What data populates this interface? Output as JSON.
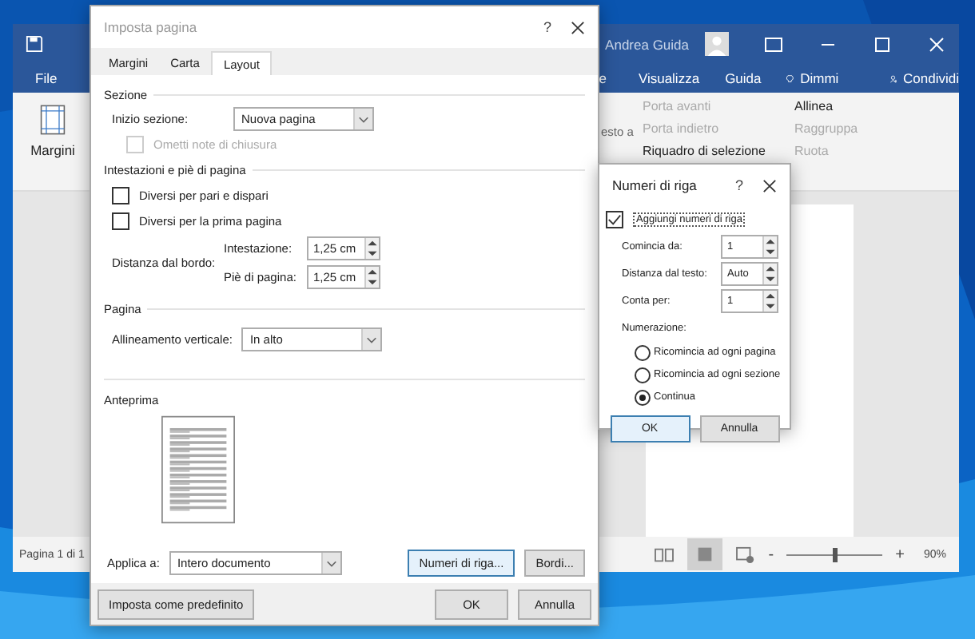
{
  "word": {
    "tabs": [
      {
        "label": "File"
      },
      {
        "label": "e"
      },
      {
        "label": "Visualizza"
      },
      {
        "label": "Guida"
      }
    ],
    "tell_me": "Dimmi",
    "share": "Condividi",
    "user": "Andrea Guida",
    "ribbon": {
      "margins": "Margini",
      "wrap": "esto a",
      "arrange": [
        {
          "label": "Porta avanti",
          "disabled": true
        },
        {
          "label": "Porta indietro",
          "disabled": true
        },
        {
          "label": "Riquadro di selezione",
          "disabled": false
        }
      ],
      "align": [
        {
          "label": "Allinea",
          "disabled": false
        },
        {
          "label": "Raggruppa",
          "disabled": true
        },
        {
          "label": "Ruota",
          "disabled": true
        }
      ]
    },
    "status_bar": {
      "page": "Pagina 1 di 1",
      "zoom_out": "-",
      "zoom_in": "+",
      "zoom": "90%",
      "level": 0.5
    }
  },
  "page_setup": {
    "title": "Imposta pagina",
    "help": "?",
    "tabs": [
      {
        "label": "Margini",
        "selected": false
      },
      {
        "label": "Carta",
        "selected": false
      },
      {
        "label": "Layout",
        "selected": true
      }
    ],
    "section": {
      "heading": "Sezione",
      "start_label": "Inizio sezione:",
      "start_value": "Nuova pagina",
      "suppress_endnotes": {
        "label": "Ometti note di chiusura",
        "checked": false,
        "disabled": true
      }
    },
    "headers": {
      "heading": "Intestazioni e piè di pagina",
      "options": [
        {
          "label": "Diversi per pari e dispari",
          "checked": false
        },
        {
          "label": "Diversi per la prima pagina",
          "checked": false
        }
      ],
      "distance_label": "Distanza dal bordo:",
      "header_label": "Intestazione:",
      "header_value": "1,25 cm",
      "footer_label": "Piè di pagina:",
      "footer_value": "1,25 cm"
    },
    "page": {
      "heading": "Pagina",
      "valign_label": "Allineamento verticale:",
      "valign_value": "In alto"
    },
    "preview": {
      "heading": "Anteprima"
    },
    "apply_label": "Applica a:",
    "apply_value": "Intero documento",
    "line_numbers_button": "Numeri di riga...",
    "borders_button": "Bordi...",
    "default_button": "Imposta come predefinito",
    "ok": "OK",
    "cancel": "Annulla"
  },
  "line_numbers": {
    "title": "Numeri di riga",
    "help": "?",
    "add": {
      "label": "Aggiungi numeri di riga",
      "checked": true
    },
    "fields": [
      {
        "label": "Comincia da:",
        "value": "1"
      },
      {
        "label": "Distanza dal testo:",
        "value": "Auto"
      },
      {
        "label": "Conta per:",
        "value": "1"
      }
    ],
    "numbering_label": "Numerazione:",
    "options": [
      {
        "label": "Ricomincia ad ogni pagina",
        "selected": false
      },
      {
        "label": "Ricomincia ad ogni sezione",
        "selected": false
      },
      {
        "label": "Continua",
        "selected": true
      }
    ],
    "ok": "OK",
    "cancel": "Annulla"
  }
}
